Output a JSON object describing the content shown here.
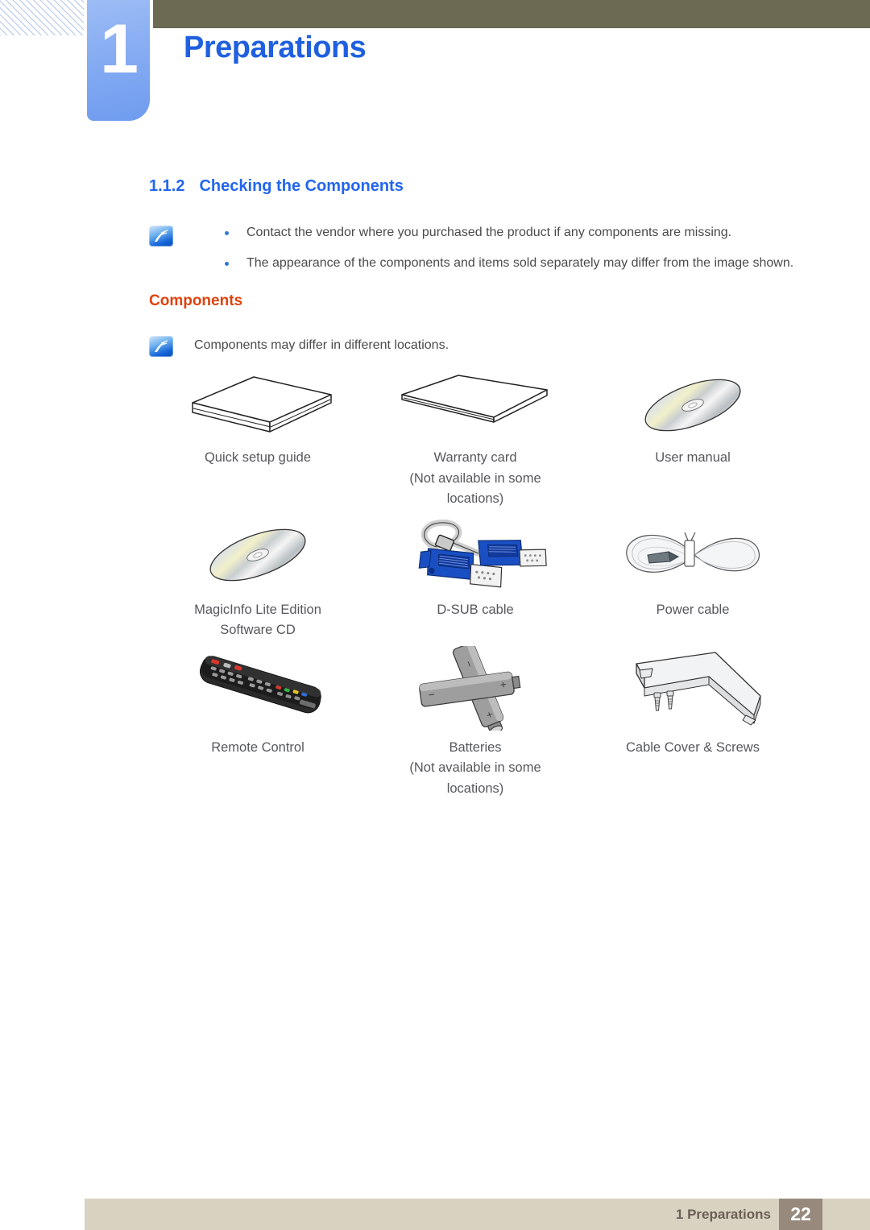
{
  "header": {
    "chapter_number": "1",
    "chapter_title": "Preparations",
    "accent_blue": "#1f5fe0",
    "bar_color": "#6d6a54"
  },
  "section": {
    "number": "1.1.2",
    "title": "Checking the Components"
  },
  "notes": {
    "top": {
      "icon": "note-icon",
      "items": [
        "Contact the vendor where you purchased the product if any components are missing.",
        "The appearance of the components and items sold separately may differ from the image shown."
      ]
    },
    "components_note": {
      "icon": "note-icon",
      "text": "Components may differ in different locations."
    }
  },
  "subsection": {
    "title": "Components",
    "color": "#e0420d"
  },
  "components": [
    [
      {
        "icon": "booklet-icon",
        "label": "Quick setup guide"
      },
      {
        "icon": "card-icon",
        "label": "Warranty card\n(Not available in some\nlocations)"
      },
      {
        "icon": "cd-disc-icon",
        "label": "User manual"
      }
    ],
    [
      {
        "icon": "cd-disc-icon",
        "label": "MagicInfo Lite Edition\nSoftware CD"
      },
      {
        "icon": "dsub-cable-icon",
        "label": "D-SUB cable"
      },
      {
        "icon": "power-cable-icon",
        "label": "Power cable"
      }
    ],
    [
      {
        "icon": "remote-control-icon",
        "label": "Remote Control"
      },
      {
        "icon": "batteries-icon",
        "label": "Batteries\n(Not available in some\nlocations)"
      },
      {
        "icon": "cable-cover-screws-icon",
        "label": "Cable Cover & Screws"
      }
    ]
  ],
  "footer": {
    "text": "1 Preparations",
    "page_number": "22",
    "bar_color": "#d8d2c0",
    "page_box_color": "#978a7d"
  }
}
